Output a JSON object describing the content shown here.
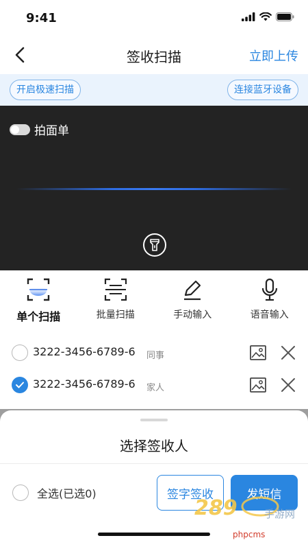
{
  "status_bar": {
    "time": "9:41"
  },
  "nav": {
    "title": "签收扫描",
    "action": "立即上传"
  },
  "options": {
    "fast_scan": "开启极速扫描",
    "bluetooth": "连接蓝牙设备"
  },
  "scanner": {
    "toggle_label": "拍面单",
    "toggle_on": false,
    "scan_line_color": "#2f6de3"
  },
  "modes": [
    {
      "label": "单个扫描",
      "icon": "single-scan-icon",
      "active": true
    },
    {
      "label": "批量扫描",
      "icon": "batch-scan-icon",
      "active": false
    },
    {
      "label": "手动输入",
      "icon": "pencil-icon",
      "active": false
    },
    {
      "label": "语音输入",
      "icon": "microphone-icon",
      "active": false
    }
  ],
  "items": [
    {
      "waybill": "3222-3456-6789-6",
      "tag": "同事",
      "checked": false
    },
    {
      "waybill": "3222-3456-6789-6",
      "tag": "家人",
      "checked": true
    }
  ],
  "sheet": {
    "title": "选择签收人",
    "select_all": "全选(已选0)",
    "sign_button": "签字签收",
    "sms_button": "发短信"
  },
  "watermark": {
    "logo_text": "289",
    "logo_sub": "手游网",
    "site": "phpcms"
  },
  "colors": {
    "accent": "#2a86e0",
    "scanner_bg": "#232323",
    "options_bg": "#eaf3fd"
  }
}
